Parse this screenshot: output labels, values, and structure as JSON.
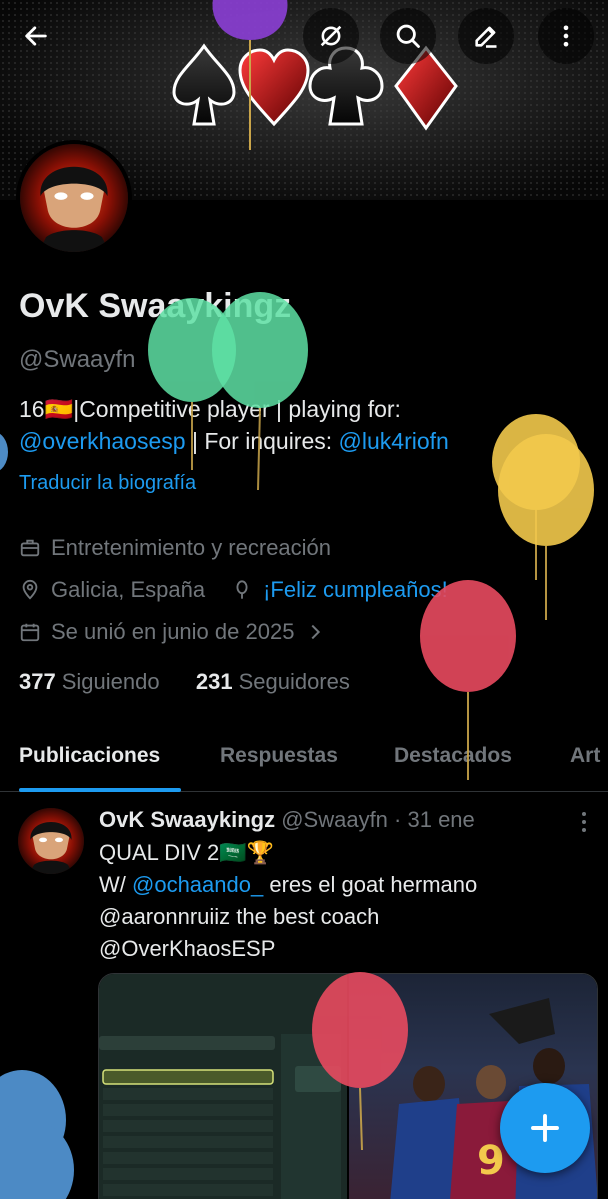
{
  "header": {
    "back_icon": "arrow-left-icon",
    "actions": [
      "no-sync-icon",
      "search-icon",
      "edit-icon",
      "more-vertical-icon"
    ]
  },
  "profile": {
    "name": "OvK Swaaykingz",
    "handle": "@Swaayfn",
    "bio_line1": "16🇪🇸|Competitive player | playing for:",
    "bio_mention1": "@overkhaosesp",
    "bio_mid": " | For inquires: ",
    "bio_mention2": "@luk4riofn",
    "translate": "Traducir la biografía",
    "category": "Entretenimiento y recreación",
    "location": "Galicia, España",
    "birthday": "¡Feliz cumpleaños!",
    "joined": "Se unió en junio de 2025",
    "following_count": "377",
    "following_label": "Siguiendo",
    "followers_count": "231",
    "followers_label": "Seguidores"
  },
  "tabs": [
    "Publicaciones",
    "Respuestas",
    "Destacados",
    "Art"
  ],
  "post": {
    "name": "OvK Swaaykingz",
    "handle": "@Swaayfn",
    "time": "· 31 ene",
    "line1": "QUAL DIV 2🇸🇦🏆",
    "line2_prefix": "W/ ",
    "line2_mention": "@ochaando_",
    "line2_suffix": " eres el goat hermano",
    "line3": "@aaronnruiiz the best coach",
    "line4": "@OverKhaosESP"
  },
  "colors": {
    "accent": "#1d9bf0",
    "muted": "#71767b",
    "text": "#e7e9ea"
  }
}
